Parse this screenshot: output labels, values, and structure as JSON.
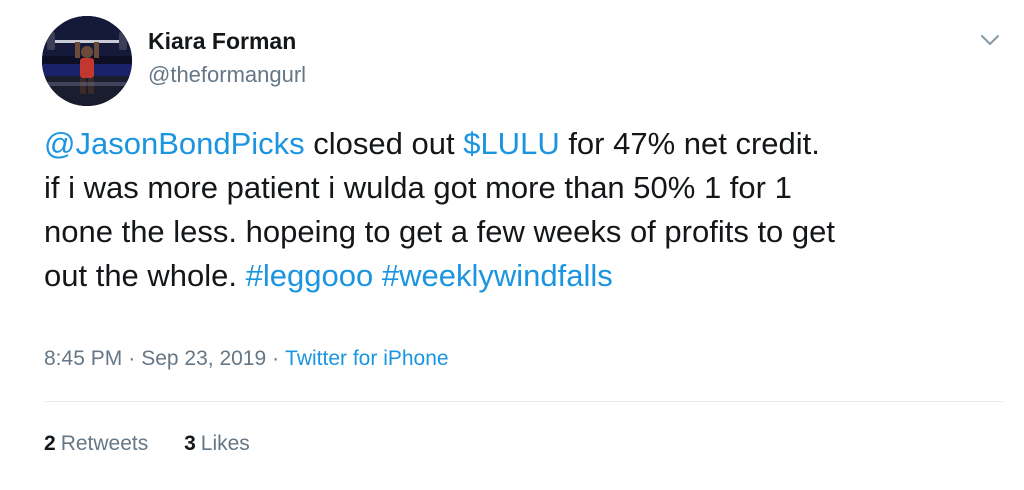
{
  "author": {
    "display_name": "Kiara Forman",
    "handle": "@theformangurl"
  },
  "tweet": {
    "line1": {
      "mention": "@JasonBondPicks",
      "text_a": " closed out ",
      "cashtag": "$LULU",
      "text_b": " for 47% net credit."
    },
    "line2": "if i was more patient i wulda got more than 50% 1 for 1",
    "line3": "none the less. hopeing to get a few weeks of profits to get",
    "line4": {
      "text": "out the whole. ",
      "hashtag1": "#leggooo",
      "space": " ",
      "hashtag2": "#weeklywindfalls"
    }
  },
  "meta": {
    "time": "8:45 PM",
    "date": "Sep 23, 2019",
    "separator": "·",
    "source": "Twitter for iPhone"
  },
  "stats": {
    "retweets_count": "2",
    "retweets_label": "Retweets",
    "likes_count": "3",
    "likes_label": "Likes"
  },
  "icons": {
    "caret": "chevron-down-icon"
  },
  "colors": {
    "link": "#1b95e0",
    "secondary_text": "#657786",
    "primary_text": "#14171a",
    "divider": "#e6ecf0"
  }
}
